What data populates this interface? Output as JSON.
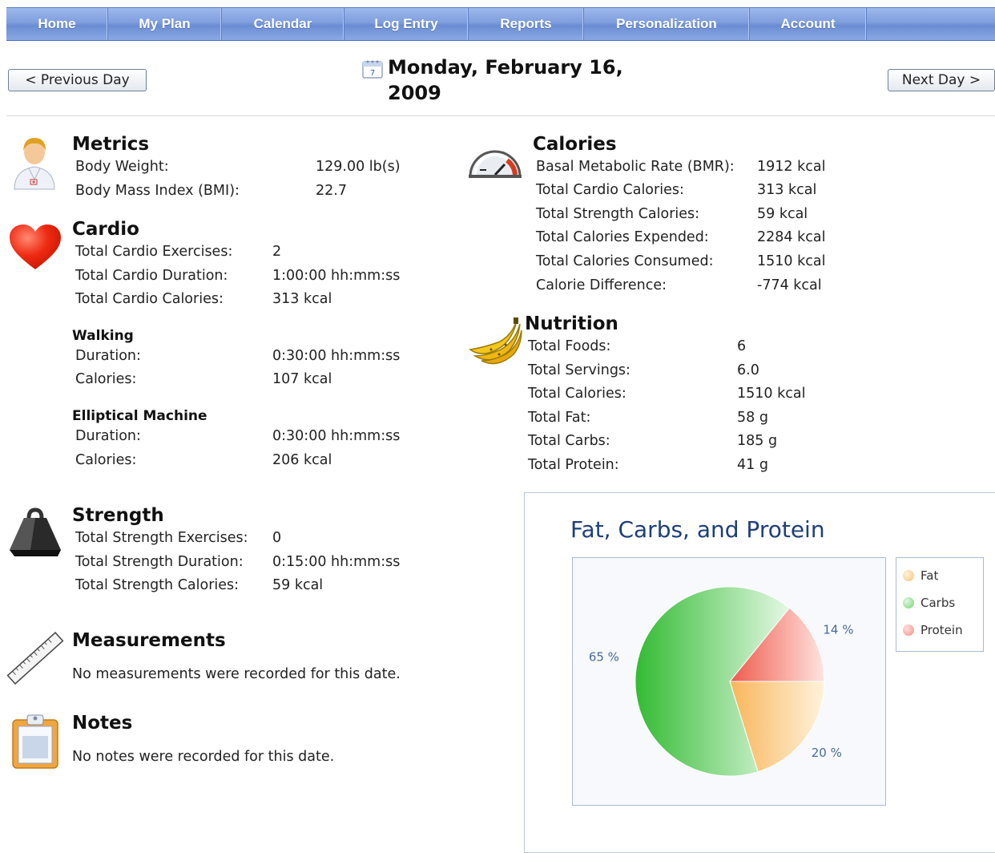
{
  "nav": {
    "tabs": [
      {
        "label": "Home"
      },
      {
        "label": "My Plan"
      },
      {
        "label": "Calendar"
      },
      {
        "label": "Log Entry"
      },
      {
        "label": "Reports"
      },
      {
        "label": "Personalization"
      },
      {
        "label": "Account"
      },
      {
        "label": ""
      }
    ]
  },
  "day_nav": {
    "prev_label": "< Previous Day",
    "next_label": "Next Day >",
    "date_line1": "Monday, February 16,",
    "date_line2": "2009",
    "calendar_icon_day": "7"
  },
  "metrics": {
    "title": "Metrics",
    "rows": [
      {
        "label": "Body Weight:",
        "value": "129.00 lb(s)"
      },
      {
        "label": "Body Mass Index (BMI):",
        "value": "22.7"
      }
    ]
  },
  "cardio": {
    "title": "Cardio",
    "rows": [
      {
        "label": "Total Cardio Exercises:",
        "value": "2"
      },
      {
        "label": "Total Cardio Duration:",
        "value": "1:00:00 hh:mm:ss"
      },
      {
        "label": "Total Cardio Calories:",
        "value": "313 kcal"
      }
    ],
    "exercises": [
      {
        "name": "Walking",
        "rows": [
          {
            "label": "Duration:",
            "value": "0:30:00 hh:mm:ss"
          },
          {
            "label": "Calories:",
            "value": "107 kcal"
          }
        ]
      },
      {
        "name": "Elliptical Machine",
        "rows": [
          {
            "label": "Duration:",
            "value": "0:30:00 hh:mm:ss"
          },
          {
            "label": "Calories:",
            "value": "206 kcal"
          }
        ]
      }
    ]
  },
  "strength": {
    "title": "Strength",
    "rows": [
      {
        "label": "Total Strength Exercises:",
        "value": "0"
      },
      {
        "label": "Total Strength Duration:",
        "value": "0:15:00 hh:mm:ss"
      },
      {
        "label": "Total Strength Calories:",
        "value": "59 kcal"
      }
    ]
  },
  "measurements": {
    "title": "Measurements",
    "note": "No measurements were recorded for this date."
  },
  "notes": {
    "title": "Notes",
    "note": "No notes were recorded for this date."
  },
  "calories": {
    "title": "Calories",
    "rows": [
      {
        "label": "Basal Metabolic Rate (BMR):",
        "value": "1912 kcal"
      },
      {
        "label": "Total Cardio Calories:",
        "value": "313 kcal"
      },
      {
        "label": "Total Strength Calories:",
        "value": "59 kcal"
      },
      {
        "label": "Total Calories Expended:",
        "value": "2284 kcal"
      },
      {
        "label": "Total Calories Consumed:",
        "value": "1510 kcal"
      },
      {
        "label": "Calorie Difference:",
        "value": "-774 kcal"
      }
    ]
  },
  "nutrition": {
    "title": "Nutrition",
    "rows": [
      {
        "label": "Total Foods:",
        "value": "6"
      },
      {
        "label": "Total Servings:",
        "value": "6.0"
      },
      {
        "label": "Total Calories:",
        "value": "1510 kcal"
      },
      {
        "label": "Total Fat:",
        "value": "58 g"
      },
      {
        "label": "Total Carbs:",
        "value": "185 g"
      },
      {
        "label": "Total Protein:",
        "value": "41 g"
      }
    ]
  },
  "colors": {
    "nav": "#7f9edd",
    "fat": "#f7b55a",
    "carbs": "#5fce5f",
    "protein": "#f3766a",
    "chart_title": "#1d3f7a"
  },
  "chart_data": {
    "type": "pie",
    "title": "Fat, Carbs, and Protein",
    "categories": [
      "Fat",
      "Carbs",
      "Protein"
    ],
    "values": [
      20,
      65,
      14
    ],
    "labels": [
      "20 %",
      "65 %",
      "14 %"
    ],
    "legend": "right"
  }
}
